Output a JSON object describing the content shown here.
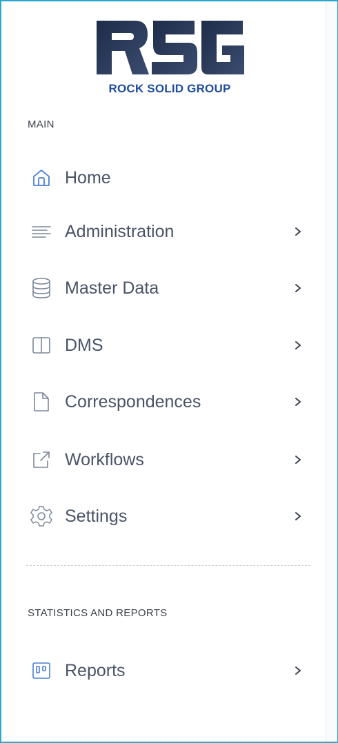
{
  "brand": {
    "logo_text": "RSG",
    "tagline": "ROCK SOLID GROUP",
    "logo_color": "#2a3c5e",
    "tagline_color": "#1f4d9e"
  },
  "sections": {
    "main": "MAIN",
    "stats": "STATISTICS AND REPORTS"
  },
  "nav": {
    "home": {
      "label": "Home",
      "icon": "home-icon"
    },
    "administration": {
      "label": "Administration",
      "icon": "lines-icon"
    },
    "master_data": {
      "label": "Master Data",
      "icon": "database-icon"
    },
    "dms": {
      "label": "DMS",
      "icon": "columns-icon"
    },
    "correspondences": {
      "label": "Correspondences",
      "icon": "document-icon"
    },
    "workflows": {
      "label": "Workflows",
      "icon": "external-link-icon"
    },
    "settings": {
      "label": "Settings",
      "icon": "gear-icon"
    },
    "reports": {
      "label": "Reports",
      "icon": "board-icon"
    }
  },
  "colors": {
    "accent": "#4a7fd4",
    "icon_gray": "#7b8799",
    "text": "#4a5466",
    "border": "#2aa6cf"
  }
}
